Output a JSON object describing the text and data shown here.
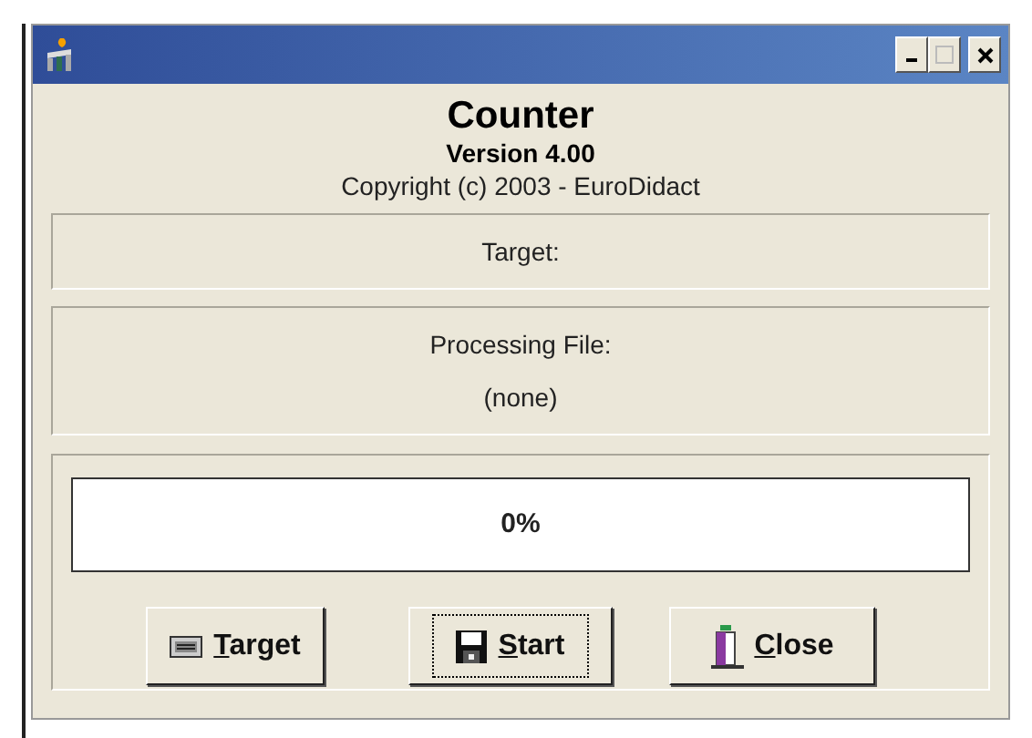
{
  "header": {
    "title": "Counter",
    "version": "Version 4.00",
    "copyright": "Copyright (c) 2003 - EuroDidact"
  },
  "target": {
    "label": "Target:"
  },
  "processing": {
    "label": "Processing File:",
    "file": "(none)"
  },
  "progress": {
    "level": 0,
    "reading": "0%"
  },
  "buttons": [
    {
      "kind": "target",
      "label": "Target",
      "focused": false
    },
    {
      "kind": "start",
      "label": "Start",
      "focused": true
    },
    {
      "kind": "close",
      "label": "Close",
      "focused": false
    }
  ]
}
